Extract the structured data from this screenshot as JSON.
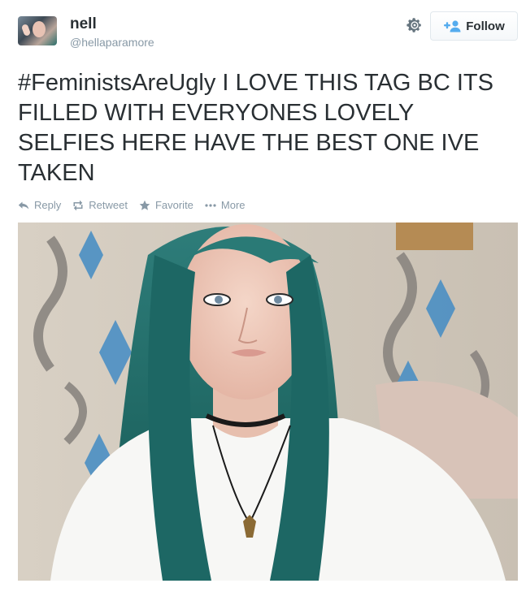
{
  "user": {
    "name": "nell",
    "handle": "@hellaparamore"
  },
  "follow_button": {
    "label": "Follow",
    "icon": "add-user-icon"
  },
  "settings_icon": "gear-icon",
  "tweet": {
    "hashtag": "#FeministsAreUgly",
    "text": " I LOVE THIS TAG BC ITS FILLED WITH EVERYONES LOVELY SELFIES HERE HAVE THE BEST ONE IVE TAKEN"
  },
  "actions": [
    {
      "label": "Reply",
      "icon": "reply-icon"
    },
    {
      "label": "Retweet",
      "icon": "retweet-icon"
    },
    {
      "label": "Favorite",
      "icon": "star-icon"
    },
    {
      "label": "More",
      "icon": "more-dots-icon"
    }
  ],
  "colors": {
    "text": "#292f33",
    "muted": "#8899a6",
    "twitter_blue": "#55acee",
    "hair_teal": "#1f6e6a"
  }
}
